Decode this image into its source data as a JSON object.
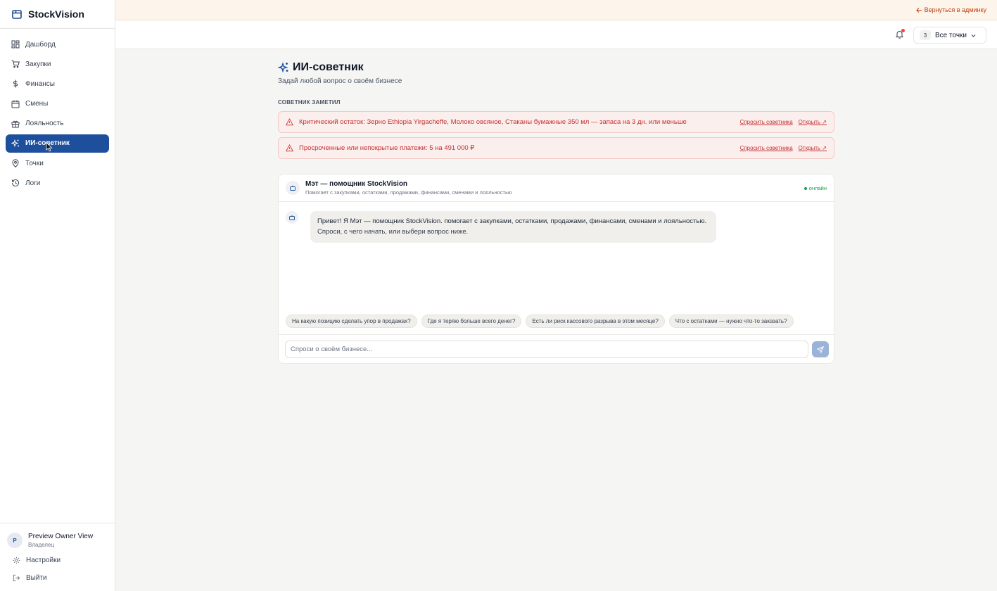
{
  "app": {
    "name": "StockVision"
  },
  "sidebar": {
    "items": [
      {
        "label": "Дашборд",
        "icon": "dashboard-icon"
      },
      {
        "label": "Закупки",
        "icon": "cart-icon"
      },
      {
        "label": "Финансы",
        "icon": "dollar-icon"
      },
      {
        "label": "Смены",
        "icon": "calendar-icon"
      },
      {
        "label": "Лояльность",
        "icon": "gift-icon"
      },
      {
        "label": "ИИ-советник",
        "icon": "sparkles-icon",
        "active": true
      },
      {
        "label": "Точки",
        "icon": "map-pin-icon"
      },
      {
        "label": "Логи",
        "icon": "history-icon"
      }
    ],
    "user": {
      "initial": "P",
      "name": "Preview Owner View",
      "role": "Владелец"
    },
    "settings_label": "Настройки",
    "logout_label": "Выйти"
  },
  "banner": {
    "back_label": "Вернуться в админку"
  },
  "header": {
    "locations_count": "3",
    "locations_label": "Все точки"
  },
  "page": {
    "title": "ИИ-советник",
    "subtitle": "Задай любой вопрос о своём бизнесе",
    "section_label": "СОВЕТНИК ЗАМЕТИЛ"
  },
  "alerts": [
    {
      "text": "Критический остаток: Зерно Ethiopia Yirgacheffe, Молоко овсяное, Стаканы бумажные 350 мл — запаса на 3 дн. или меньше",
      "ask_label": "Спросить советника",
      "open_label": "Открыть ↗"
    },
    {
      "text": "Просроченные или непокрытые платежи: 5 на 491 000 ₽",
      "ask_label": "Спросить советника",
      "open_label": "Открыть ↗"
    }
  ],
  "chat": {
    "title": "Мэт — помощник StockVision",
    "subtitle": "Помогает с закупками, остатками, продажами, финансами, сменами и лояльностью",
    "status": "онлайн",
    "message_line1": "Привет! Я Мэт — помощник StockVision. помогает с закупками, остатками, продажами, финансами, сменами и лояльностью.",
    "message_line2": "Спроси, с чего начать, или выбери вопрос ниже.",
    "suggestions": [
      "На какую позицию сделать упор в продажах?",
      "Где я теряю больше всего денег?",
      "Есть ли риск кассового разрыва в этом месяце?",
      "Что с остатками — нужно что-то заказать?"
    ],
    "input_value": "",
    "input_placeholder": "Спроси о своём бизнесе..."
  },
  "colors": {
    "accent": "#1e4f9c",
    "alert_text": "#c53030",
    "alert_bg": "#fbefee",
    "online": "#16a34a",
    "banner_link": "#c2410c"
  }
}
